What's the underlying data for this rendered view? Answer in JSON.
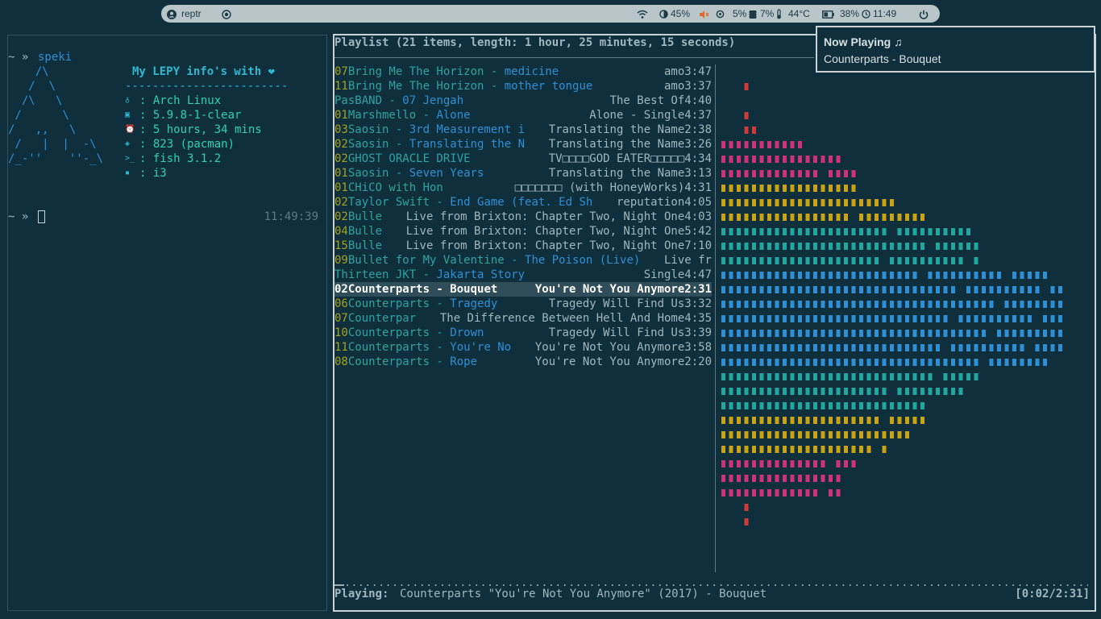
{
  "topbar": {
    "workspace": "reptr",
    "wifi_icon": "wifi-icon",
    "brightness": "45%",
    "volume_icon": "muted-speaker-icon",
    "cpu": "5%",
    "memory": "7%",
    "temperature": "44°C",
    "battery": "38%",
    "time": "11:49",
    "colors": {
      "bar": "#b9c6c9",
      "muted": "#e06a2c"
    }
  },
  "terminal": {
    "prompt1": "~ »",
    "command": "speki",
    "ascii_logo": [
      "    /\\",
      "   /  \\",
      "  /\\   \\",
      " /      \\",
      "/   ,,   \\",
      " /   |  |  -\\",
      "/_-''    ''-_\\"
    ],
    "header": "My LEPY info's with ❤",
    "divider": "------------------------",
    "info": [
      {
        "icon": "penguin-icon",
        "glyph": "♁",
        "value": ": Arch Linux"
      },
      {
        "icon": "chip-icon",
        "glyph": "▣",
        "value": ": 5.9.8-1-clear"
      },
      {
        "icon": "clock-icon",
        "glyph": "⏰",
        "value": ": 5 hours, 34 mins"
      },
      {
        "icon": "package-icon",
        "glyph": "◈",
        "value": ": 823 (pacman)"
      },
      {
        "icon": "shell-icon",
        "glyph": ">_",
        "value": ": fish 3.1.2"
      },
      {
        "icon": "window-icon",
        "glyph": "▪",
        "value": ": i3"
      }
    ],
    "prompt2": "~ »",
    "right_time": "11:49:39"
  },
  "player": {
    "header": "Playlist (21 items, length: 1 hour, 25 minutes, 15 seconds)",
    "playlist": [
      {
        "num": "07",
        "artist": "Bring Me The Horizon - ",
        "title": "medicine",
        "album": "amo",
        "length": "3:47"
      },
      {
        "num": "11",
        "artist": "Bring Me The Horizon - ",
        "title": "mother tongue",
        "album": "amo",
        "length": "3:37"
      },
      {
        "num": "",
        "artist": "PasBAND - ",
        "title": "07 Jengah",
        "album": "The Best Of",
        "length": "4:40"
      },
      {
        "num": "01",
        "artist": "Marshmello - ",
        "title": "Alone",
        "album": "Alone - Single",
        "length": "4:37"
      },
      {
        "num": "03",
        "artist": "Saosin - ",
        "title": "3rd Measurement i",
        "album": "Translating the Name",
        "length": "2:38"
      },
      {
        "num": "02",
        "artist": "Saosin - ",
        "title": "Translating the N",
        "album": "Translating the Name",
        "length": "3:26"
      },
      {
        "num": "02",
        "artist": "GHOST ORACLE DRIVE",
        "title": "",
        "album": "TV□□□□GOD EATER□□□□□",
        "length": "4:34"
      },
      {
        "num": "01",
        "artist": "Saosin - ",
        "title": "Seven Years",
        "album": "Translating the Name",
        "length": "3:13"
      },
      {
        "num": "01",
        "artist": "CHiCO with Hon",
        "title": "",
        "album": "□□□□□□□ (with HoneyWorks)",
        "length": "4:31"
      },
      {
        "num": "02",
        "artist": "Taylor Swift - ",
        "title": "End Game (feat. Ed Sh",
        "album": "reputation",
        "length": "4:05"
      },
      {
        "num": "02",
        "artist": "Bulle",
        "title": "",
        "album": "Live from Brixton: Chapter Two, Night One",
        "length": "4:03"
      },
      {
        "num": "04",
        "artist": "Bulle",
        "title": "",
        "album": "Live from Brixton: Chapter Two, Night One",
        "length": "5:42"
      },
      {
        "num": "15",
        "artist": "Bulle",
        "title": "",
        "album": "Live from Brixton: Chapter Two, Night One",
        "length": "7:10"
      },
      {
        "num": "09",
        "artist": "Bullet for My Valentine - ",
        "title": "The Poison (Live)",
        "album": "Live fr",
        "length": ""
      },
      {
        "num": "",
        "artist": "Thirteen JKT - ",
        "title": "Jakarta Story",
        "album": "Single",
        "length": "4:47"
      },
      {
        "num": "02",
        "artist": "Counterparts - ",
        "title": "Bouquet ",
        "album": "You're Not You Anymore",
        "length": "2:31"
      },
      {
        "num": "06",
        "artist": "Counterparts - ",
        "title": "Tragedy",
        "album": "Tragedy Will Find Us",
        "length": "3:32"
      },
      {
        "num": "07",
        "artist": "Counterpar",
        "title": "",
        "album": "The Difference Between Hell And Home",
        "length": "4:35"
      },
      {
        "num": "10",
        "artist": "Counterparts - ",
        "title": "Drown",
        "album": "Tragedy Will Find Us",
        "length": "3:39"
      },
      {
        "num": "11",
        "artist": "Counterparts - ",
        "title": "You're No",
        "album": "You're Not You Anymore",
        "length": "3:58"
      },
      {
        "num": "08",
        "artist": "Counterparts - ",
        "title": "Rope",
        "album": "You're Not You Anymore",
        "length": "2:20"
      }
    ],
    "selected_index": 15,
    "visualizer_colors": [
      "#d03a3a",
      "#d0327a",
      "#c9a312",
      "#20a8a0",
      "#2f8fd5"
    ],
    "progress_fraction": 0.013,
    "status_label": "Playing:",
    "status_text": "Counterparts \"You're Not You Anymore\" (2017) - Bouquet",
    "time": "[0:02/2:31]"
  },
  "notification": {
    "title": "Now Playing ♫",
    "body": "Counterparts - Bouquet"
  }
}
